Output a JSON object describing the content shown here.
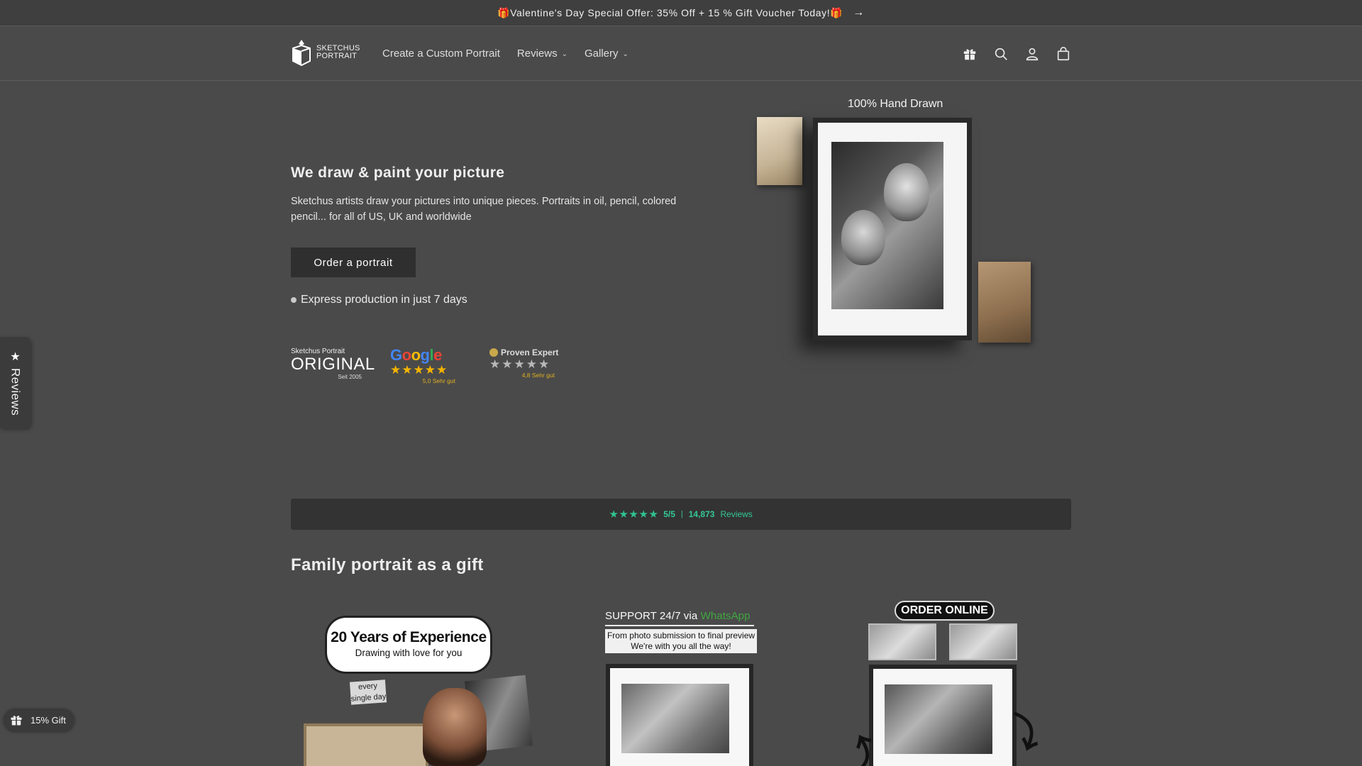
{
  "announcement": {
    "text": "🎁Valentine's Day Special Offer: 35% Off + 15 % Gift Voucher Today!🎁",
    "arrow": "→"
  },
  "logo": {
    "line1": "SKETCHUS",
    "line2": "PORTRAIT"
  },
  "nav": {
    "items": [
      {
        "label": "Create a Custom Portrait",
        "has_dropdown": false
      },
      {
        "label": "Reviews",
        "has_dropdown": true
      },
      {
        "label": "Gallery",
        "has_dropdown": true
      }
    ]
  },
  "header_icons": [
    "gift-icon",
    "search-icon",
    "account-icon",
    "cart-icon"
  ],
  "hero": {
    "title": "We draw & paint your picture",
    "text": "Sketchus artists draw your pictures into unique pieces. Portraits in oil, pencil, colored pencil... for all of US, UK and worldwide",
    "button": "Order a portrait",
    "express": "Express production in just 7 days",
    "image_caption": "100% Hand Drawn"
  },
  "badges": {
    "original": {
      "small": "Sketchus Portrait",
      "big": "ORIGINAL",
      "since": "Seit 2005"
    },
    "google": {
      "logo": "Google",
      "stars": "★★★★★",
      "sub": "5,0 Sehr gut"
    },
    "proven_expert": {
      "logo": "Proven Expert",
      "sub": "4,8 Sehr gut",
      "stars": "★★★★★"
    }
  },
  "reviews_bar": {
    "score": "5/5",
    "separator": "|",
    "count": "14,873",
    "label": "Reviews",
    "star_color": "#2fc48f"
  },
  "section": {
    "title": "Family portrait as a gift"
  },
  "cards": {
    "card1": {
      "line1": "20 Years of Experience",
      "line2": "Drawing with love for you",
      "note": "every single day"
    },
    "card2": {
      "support": "SUPPORT 24/7 via",
      "whatsapp": "WhatsApp",
      "sub1": "From photo submission to final preview",
      "sub2": "We're with you all the way!"
    },
    "card3": {
      "badge": "ORDER ONLINE"
    }
  },
  "side_tab": {
    "label": "Reviews",
    "icon": "star-icon"
  },
  "gift_pill": {
    "label": "15% Gift",
    "icon": "gift-icon"
  },
  "colors": {
    "background": "#4a4a4a",
    "accent_green": "#33c997",
    "button": "#2f2f2f"
  }
}
